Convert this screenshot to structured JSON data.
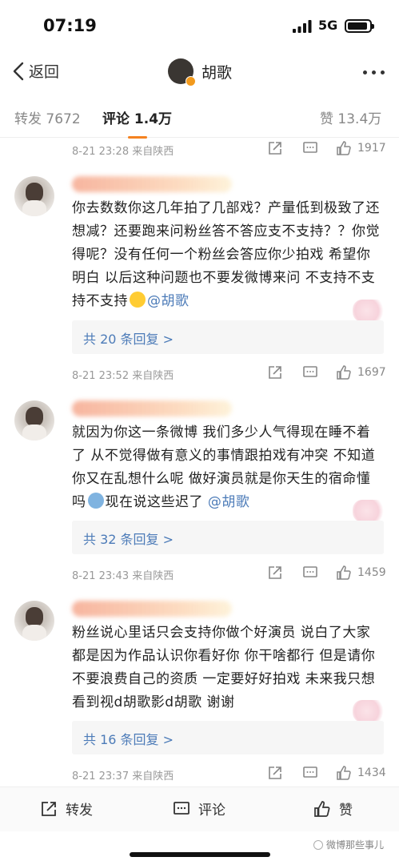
{
  "status_bar": {
    "time": "07:19",
    "network": "5G"
  },
  "nav": {
    "back_label": "返回",
    "title": "胡歌"
  },
  "tabs": [
    {
      "label": "转发 7672",
      "active": false
    },
    {
      "label": "评论 1.4万",
      "active": true
    },
    {
      "label": "赞 13.4万",
      "active": false
    }
  ],
  "top_meta": {
    "time": "8-21 23:28 来自陕西",
    "likes": "1917"
  },
  "comments": [
    {
      "text": "你去数数你这几年拍了几部戏？产量低到极致了还想减？还要跑来问粉丝答不答应支不支持？？你觉得呢？没有任何一个粉丝会答应你少拍戏 希望你明白 以后这种问题也不要发微博来问 不支持不支持不支持",
      "mention": "@胡歌",
      "replies": "共 20 条回复 >",
      "time": "8-21 23:52 来自陕西",
      "likes": "1697"
    },
    {
      "text": "就因为你这一条微博 我们多少人气得现在睡不着了  从不觉得做有意义的事情跟拍戏有冲突 不知道你又在乱想什么呢 做好演员就是你天生的宿命懂吗",
      "text_after": "现在说这些迟了",
      "mention": "@胡歌",
      "replies": "共 32 条回复 >",
      "time": "8-21 23:43 来自陕西",
      "likes": "1459"
    },
    {
      "text": "粉丝说心里话只会支持你做个好演员 说白了大家都是因为作品认识你看好你 你干啥都行 但是请你不要浪费自己的资质 一定要好好拍戏 未来我只想看到视d胡歌影d胡歌 谢谢",
      "mention": "",
      "replies": "共 16 条回复 >",
      "time": "8-21 23:37 来自陕西",
      "likes": "1434"
    }
  ],
  "bottom_bar": {
    "repost": "转发",
    "comment": "评论",
    "like": "赞"
  },
  "watermark": "微博那些事儿",
  "colors": {
    "accent": "#f58220",
    "link": "#4c7bb8",
    "badge": "#f29a1d"
  }
}
